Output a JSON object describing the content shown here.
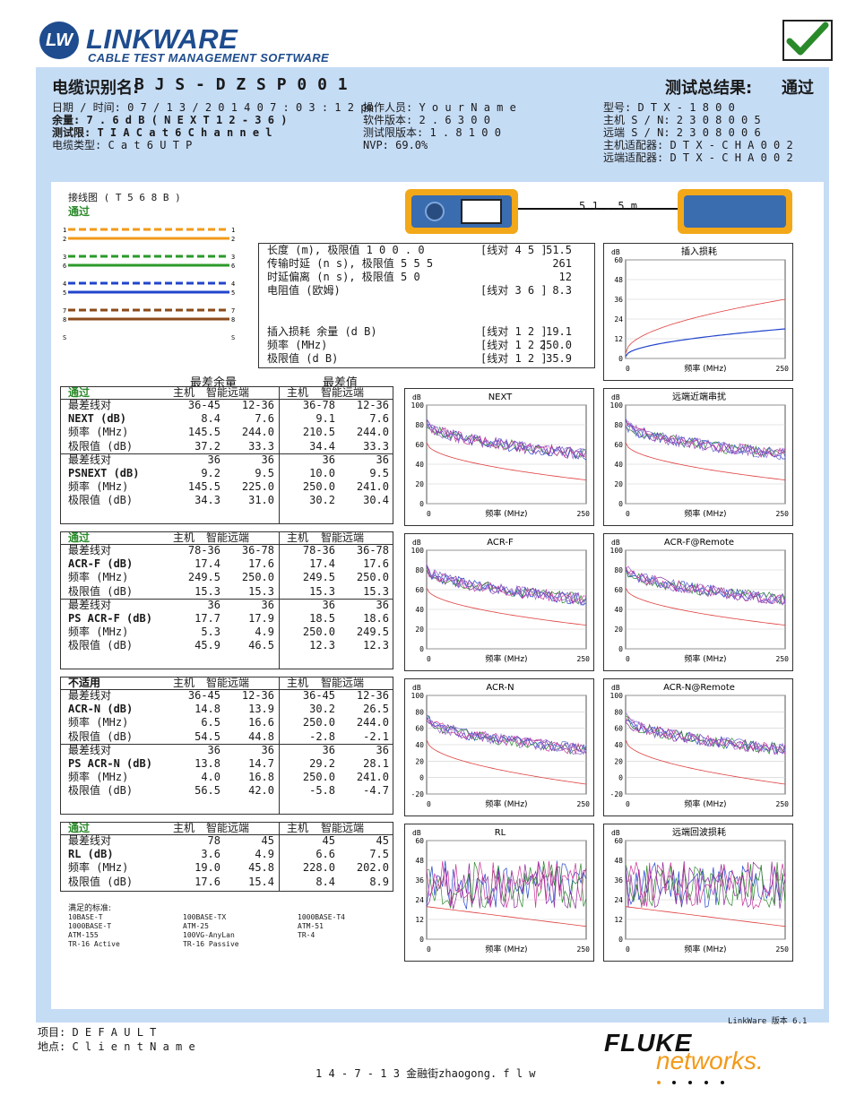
{
  "logo": {
    "badge": "LW",
    "title": "LINKWARE",
    "subtitle": "CABLE TEST MANAGEMENT SOFTWARE"
  },
  "header": {
    "cable_id_label": "电缆识别名:",
    "cable_id": "B J S - D Z S P 0 0 1",
    "result_label": "测试总结果:",
    "result": "通过",
    "col1": [
      "日期 / 时间: 0 7 / 1 3 / 2 0 1 4 0 7 : 0 3 : 1 2 pm",
      "余量: 7 . 6 d B ( N E X T 1 2 - 3 6 )",
      "测试限: T I A C a t 6 C h a n n e l",
      "电缆类型: C a t 6 U T P"
    ],
    "col2": [
      "操作人员: Y o u r N a m e",
      "软件版本: 2 . 6 3 0 0",
      "测试限版本: 1 . 8 1 0 0",
      "NVP: 69.0%"
    ],
    "col3": [
      "型号: D T X - 1 8 0 0",
      "主机 S / N: 2 3 0 8 0 0 5",
      "远端 S / N: 2 3 0 8 0 0 6",
      "主机适配器: D T X - C H A 0 0 2",
      "远端适配器: D T X - C H A 0 0 2"
    ]
  },
  "wiremap": {
    "title": "接线图 ( T 5 6 8 B )",
    "status": "通过",
    "left_pins": [
      "1",
      "2",
      "3",
      "6",
      "4",
      "5",
      "7",
      "8",
      "S"
    ],
    "right_pins": [
      "1",
      "2",
      "3",
      "6",
      "4",
      "5",
      "7",
      "8",
      "S"
    ]
  },
  "length_display": "5 1 . 5 m",
  "summary": {
    "rows": [
      {
        "label": "长度 (m), 极限值 1 0 0 . 0",
        "pair": "[线对 4 5 ]",
        "value": "51.5"
      },
      {
        "label": "传输时延 (n s), 极限值 5 5 5",
        "pair": "",
        "value": "261"
      },
      {
        "label": "时延偏离 (n s), 极限值 5 0",
        "pair": "",
        "value": "12"
      },
      {
        "label": "电阻值 (欧姆)",
        "pair": "[线对 3 6 ]",
        "value": "8.3"
      },
      {
        "label": "插入损耗 余量 (d B)",
        "pair": "[线对 1 2 ]",
        "value": "19.1"
      },
      {
        "label": "频率 (MHz)",
        "pair": "[线对 1 2 ]",
        "value": "250.0"
      },
      {
        "label": "极限值 (d B)",
        "pair": "[线对 1 2 ]",
        "value": "35.9"
      }
    ]
  },
  "results": {
    "heading_worst_margin": "最差余量",
    "heading_worst_value": "最差值",
    "col_main": "主机",
    "col_remote": "智能远端",
    "tables": [
      {
        "status": "通过",
        "groups": [
          {
            "rows": [
              [
                "最差线对",
                "36-45",
                "12-36",
                "36-78",
                "12-36"
              ],
              [
                "NEXT (dB)",
                "8.4",
                "7.6",
                "9.1",
                "7.6"
              ],
              [
                "频率 (MHz)",
                "145.5",
                "244.0",
                "210.5",
                "244.0"
              ],
              [
                "极限值 (dB)",
                "37.2",
                "33.3",
                "34.4",
                "33.3"
              ]
            ]
          },
          {
            "rows": [
              [
                "最差线对",
                "36",
                "36",
                "36",
                "36"
              ],
              [
                "PSNEXT (dB)",
                "9.2",
                "9.5",
                "10.0",
                "9.5"
              ],
              [
                "频率 (MHz)",
                "145.5",
                "225.0",
                "250.0",
                "241.0"
              ],
              [
                "极限值 (dB)",
                "34.3",
                "31.0",
                "30.2",
                "30.4"
              ]
            ]
          }
        ]
      },
      {
        "status": "通过",
        "groups": [
          {
            "rows": [
              [
                "最差线对",
                "78-36",
                "36-78",
                "78-36",
                "36-78"
              ],
              [
                "ACR-F (dB)",
                "17.4",
                "17.6",
                "17.4",
                "17.6"
              ],
              [
                "频率 (MHz)",
                "249.5",
                "250.0",
                "249.5",
                "250.0"
              ],
              [
                "极限值 (dB)",
                "15.3",
                "15.3",
                "15.3",
                "15.3"
              ]
            ]
          },
          {
            "rows": [
              [
                "最差线对",
                "36",
                "36",
                "36",
                "36"
              ],
              [
                "PS ACR-F (dB)",
                "17.7",
                "17.9",
                "18.5",
                "18.6"
              ],
              [
                "频率 (MHz)",
                "5.3",
                "4.9",
                "250.0",
                "249.5"
              ],
              [
                "极限值 (dB)",
                "45.9",
                "46.5",
                "12.3",
                "12.3"
              ]
            ]
          }
        ]
      },
      {
        "status": "不适用",
        "groups": [
          {
            "rows": [
              [
                "最差线对",
                "36-45",
                "12-36",
                "36-45",
                "12-36"
              ],
              [
                "ACR-N (dB)",
                "14.8",
                "13.9",
                "30.2",
                "26.5"
              ],
              [
                "频率 (MHz)",
                "6.5",
                "16.6",
                "250.0",
                "244.0"
              ],
              [
                "极限值 (dB)",
                "54.5",
                "44.8",
                "-2.8",
                "-2.1"
              ]
            ]
          },
          {
            "rows": [
              [
                "最差线对",
                "36",
                "36",
                "36",
                "36"
              ],
              [
                "PS ACR-N (dB)",
                "13.8",
                "14.7",
                "29.2",
                "28.1"
              ],
              [
                "频率 (MHz)",
                "4.0",
                "16.8",
                "250.0",
                "241.0"
              ],
              [
                "极限值 (dB)",
                "56.5",
                "42.0",
                "-5.8",
                "-4.7"
              ]
            ]
          }
        ]
      },
      {
        "status": "通过",
        "groups": [
          {
            "rows": [
              [
                "最差线对",
                "78",
                "45",
                "45",
                "45"
              ],
              [
                "RL (dB)",
                "3.6",
                "4.9",
                "6.6",
                "7.5"
              ],
              [
                "频率 (MHz)",
                "19.0",
                "45.8",
                "228.0",
                "202.0"
              ],
              [
                "极限值 (dB)",
                "17.6",
                "15.4",
                "8.4",
                "8.9"
              ]
            ]
          }
        ]
      }
    ]
  },
  "standards": {
    "title": "满足的标准:",
    "items": [
      "10BASE-T",
      "100BASE-TX",
      "1000BASE-T4",
      "1000BASE-T",
      "ATM-25",
      "ATM-51",
      "ATM-155",
      "100VG-AnyLan",
      "TR-4",
      "TR-16 Active",
      "TR-16 Passive"
    ]
  },
  "chart_data": [
    {
      "type": "line",
      "title": "插入损耗",
      "ylabel": "dB",
      "xlabel": "频率 (MHz)",
      "ylim": [
        0,
        60
      ],
      "yticks": [
        "0",
        "12",
        "24",
        "36",
        "48",
        "60"
      ],
      "xticks": [
        "0",
        "250"
      ]
    },
    {
      "type": "line",
      "title": "NEXT",
      "ylabel": "dB",
      "xlabel": "频率 (MHz)",
      "ylim": [
        0,
        100
      ],
      "yticks": [
        "0",
        "20",
        "40",
        "60",
        "80",
        "100"
      ],
      "xticks": [
        "0",
        "250"
      ]
    },
    {
      "type": "line",
      "title": "远端近端串扰",
      "ylabel": "dB",
      "xlabel": "频率 (MHz)",
      "ylim": [
        0,
        100
      ],
      "yticks": [
        "0",
        "20",
        "40",
        "60",
        "80",
        "100"
      ],
      "xticks": [
        "0",
        "250"
      ]
    },
    {
      "type": "line",
      "title": "ACR-F",
      "ylabel": "dB",
      "xlabel": "频率 (MHz)",
      "ylim": [
        0,
        100
      ],
      "yticks": [
        "0",
        "20",
        "40",
        "60",
        "80",
        "100"
      ],
      "xticks": [
        "0",
        "250"
      ]
    },
    {
      "type": "line",
      "title": "ACR-F@Remote",
      "ylabel": "dB",
      "xlabel": "频率 (MHz)",
      "ylim": [
        0,
        100
      ],
      "yticks": [
        "0",
        "20",
        "40",
        "60",
        "80",
        "100"
      ],
      "xticks": [
        "0",
        "250"
      ]
    },
    {
      "type": "line",
      "title": "ACR-N",
      "ylabel": "dB",
      "xlabel": "频率 (MHz)",
      "ylim": [
        -20,
        100
      ],
      "yticks": [
        "-20",
        "0",
        "20",
        "40",
        "60",
        "80",
        "100"
      ],
      "xticks": [
        "0",
        "250"
      ]
    },
    {
      "type": "line",
      "title": "ACR-N@Remote",
      "ylabel": "dB",
      "xlabel": "频率 (MHz)",
      "ylim": [
        -20,
        100
      ],
      "yticks": [
        "-20",
        "0",
        "20",
        "40",
        "60",
        "80",
        "100"
      ],
      "xticks": [
        "0",
        "250"
      ]
    },
    {
      "type": "line",
      "title": "RL",
      "ylabel": "dB",
      "xlabel": "频率 (MHz)",
      "ylim": [
        0,
        60
      ],
      "yticks": [
        "0",
        "12",
        "24",
        "36",
        "48",
        "60"
      ],
      "xticks": [
        "0",
        "250"
      ]
    },
    {
      "type": "line",
      "title": "远端回波损耗",
      "ylabel": "dB",
      "xlabel": "频率 (MHz)",
      "ylim": [
        0,
        60
      ],
      "yticks": [
        "0",
        "12",
        "24",
        "36",
        "48",
        "60"
      ],
      "xticks": [
        "0",
        "250"
      ]
    }
  ],
  "footer": {
    "version": "LinkWare 版本 6.1",
    "project": "项目: D E F A U L T",
    "site": "地点: C l i e n t N a m e",
    "file": "1 4 - 7 - 1 3 金融街zhaogong. f l w",
    "brand_top": "FLUKE",
    "brand_bottom": "networks."
  },
  "colors": {
    "band": "#c5dcf5",
    "brand_blue": "#1e4c8e",
    "check_green": "#2a8a2a",
    "limit_red": "#e04040"
  }
}
